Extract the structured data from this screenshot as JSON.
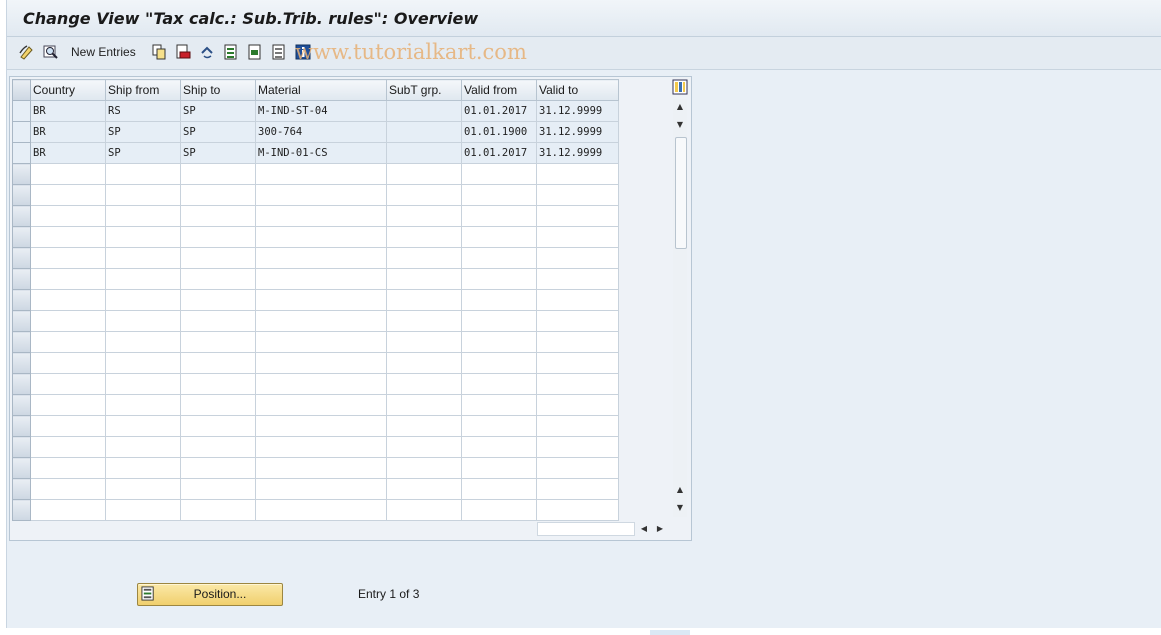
{
  "window": {
    "title": "Change View \"Tax calc.: Sub.Trib. rules\": Overview"
  },
  "toolbar": {
    "new_entries_label": "New Entries",
    "icons": [
      "change-display-icon",
      "find-icon",
      "copy-as-icon",
      "delete-icon",
      "undo-icon",
      "select-all-icon",
      "select-block-icon",
      "deselect-all-icon",
      "info-icon"
    ],
    "watermark": "www.tutorialkart.com"
  },
  "table": {
    "columns": [
      "Country",
      "Ship from",
      "Ship to",
      "Material",
      "SubT grp.",
      "Valid from",
      "Valid to"
    ],
    "rows": [
      {
        "country": "BR",
        "ship_from": "RS",
        "ship_to": "SP",
        "material": "M-IND-ST-04",
        "subt_grp": "",
        "valid_from": "01.01.2017",
        "valid_to": "31.12.9999"
      },
      {
        "country": "BR",
        "ship_from": "SP",
        "ship_to": "SP",
        "material": "300-764",
        "subt_grp": "",
        "valid_from": "01.01.1900",
        "valid_to": "31.12.9999"
      },
      {
        "country": "BR",
        "ship_from": "SP",
        "ship_to": "SP",
        "material": "M-IND-01-CS",
        "subt_grp": "",
        "valid_from": "01.01.2017",
        "valid_to": "31.12.9999"
      }
    ],
    "visible_row_slots": 20
  },
  "footer": {
    "position_button_label": "Position...",
    "entry_status": "Entry 1 of 3"
  }
}
